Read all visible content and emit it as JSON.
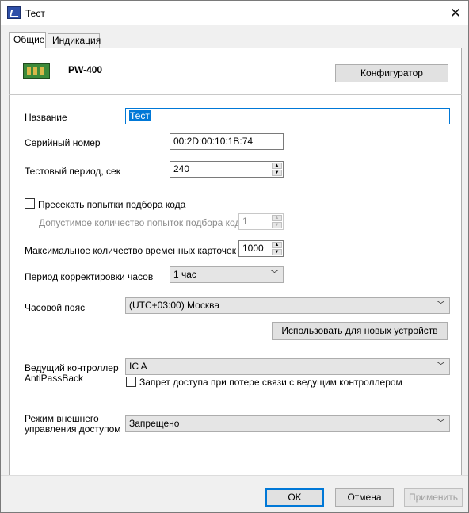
{
  "window": {
    "title": "Тест"
  },
  "tabs": [
    {
      "label": "Общие",
      "active": true
    },
    {
      "label": "Индикация",
      "active": false
    }
  ],
  "device": {
    "name": "PW-400",
    "configurator_label": "Конфигуратор"
  },
  "fields": {
    "name": {
      "label": "Название",
      "value": "Тест"
    },
    "serial": {
      "label": "Серийный номер",
      "value": "00:2D:00:10:1B:74"
    },
    "test_period": {
      "label": "Тестовый период, сек",
      "value": "240"
    },
    "block_guess": {
      "label": "Пресекать попытки подбора кода",
      "checked": false
    },
    "guess_attempts": {
      "label": "Допустимое количество попыток подбора кода",
      "value": "1"
    },
    "temp_cards": {
      "label": "Максимальное количество временных карточек",
      "value": "1000"
    },
    "clock_period": {
      "label": "Период корректировки часов",
      "value": "1 час"
    },
    "timezone": {
      "label": "Часовой пояс",
      "value": "(UTC+03:00) Москва",
      "apply_label": "Использовать для новых устройств"
    },
    "master_controller": {
      "label_line1": "Ведущий контроллер",
      "label_line2": "AntiPassBack",
      "value": "IC A"
    },
    "deny_on_loss": {
      "label": "Запрет доступа при потере связи с ведущим контроллером",
      "checked": false
    },
    "external_mode": {
      "label_line1": "Режим внешнего",
      "label_line2": "управления доступом",
      "value": "Запрещено"
    }
  },
  "footer": {
    "ok": "OK",
    "cancel": "Отмена",
    "apply": "Применить"
  },
  "icons": {
    "close": "close-icon",
    "chevron": "chevron-down-icon",
    "spin_up": "spin-up-icon",
    "spin_down": "spin-down-icon"
  }
}
